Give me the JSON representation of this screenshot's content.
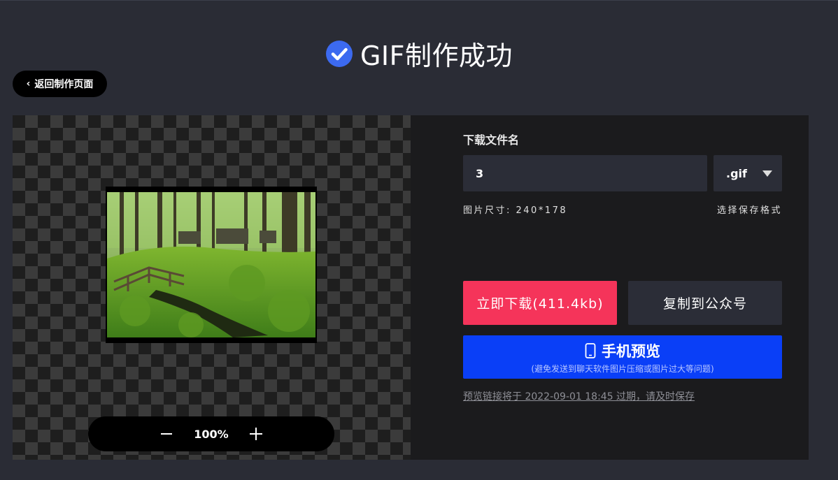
{
  "header": {
    "title": "GIF制作成功",
    "back_label": "返回制作页面"
  },
  "preview": {
    "zoom_level": "100%",
    "zoom_out_icon": "minus-icon",
    "zoom_in_icon": "plus-icon"
  },
  "side": {
    "filename_label": "下载文件名",
    "filename_value": "3",
    "format_value": ".gif",
    "image_size": "图片尺寸: 240*178",
    "select_format_label": "选择保存格式",
    "download_label": "立即下载(411.4kb)",
    "copy_label": "复制到公众号",
    "mobile_preview_label": "手机预览",
    "mobile_preview_sub": "(避免发送到聊天软件图片压缩或图片过大等问题)",
    "expire_note": "预览链接将于 2022-09-01 18:45 过期，请及时保存"
  },
  "colors": {
    "background": "#2a2c35",
    "panel": "#1b1b1d",
    "accent_check": "#3c6af0",
    "download": "#f5345a",
    "mobile": "#0a3ff7",
    "input": "#2b2d37"
  }
}
